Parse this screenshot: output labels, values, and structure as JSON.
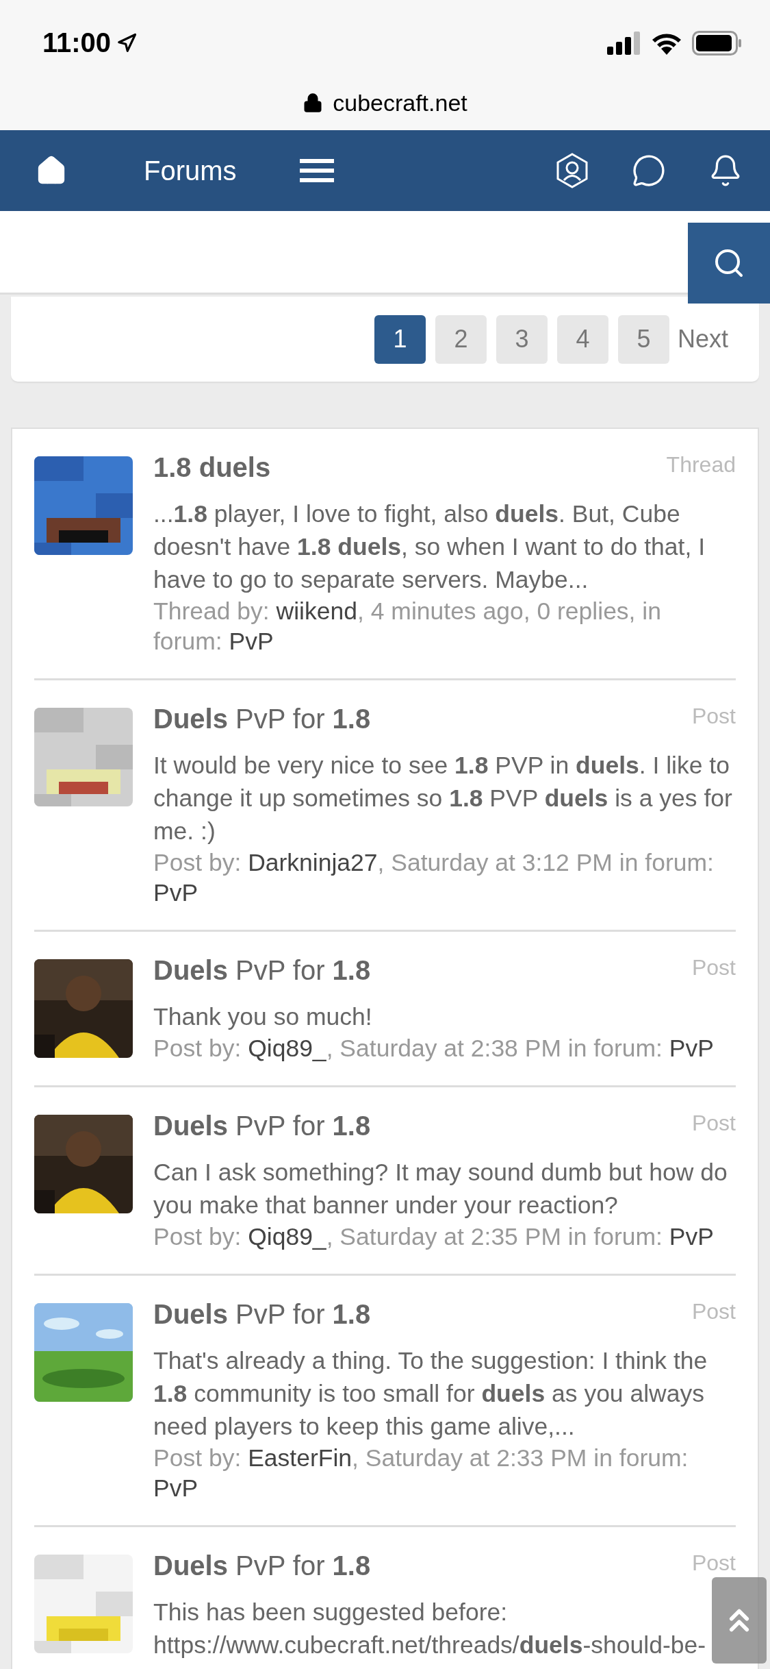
{
  "status_bar": {
    "time": "11:00"
  },
  "browser": {
    "url": "cubecraft.net"
  },
  "nav": {
    "title": "Forums"
  },
  "pagination": {
    "pages": [
      {
        "label": "1",
        "selected": true
      },
      {
        "label": "2",
        "selected": false
      },
      {
        "label": "3",
        "selected": false
      },
      {
        "label": "4",
        "selected": false
      },
      {
        "label": "5",
        "selected": false
      }
    ],
    "next": "Next"
  },
  "results": [
    {
      "title": "**1.8 duels**",
      "type": "Thread",
      "snippet": "...**1.8** player, I love to fight, also **duels**. But, Cube doesn't have **1.8 duels**, so when I want to do that, I have to go to separate servers. Maybe...",
      "meta": {
        "prefix": "Thread by:",
        "author": "wiikend",
        "details": ", 4 minutes ago, 0 replies, in forum:",
        "forum": "PvP"
      }
    },
    {
      "title": "**Duels** PvP for **1.8**",
      "type": "Post",
      "snippet": "It would be very nice to see **1.8** PVP in **duels**. I like to change it up sometimes so **1.8** PVP **duels** is a yes for me. :)",
      "meta": {
        "prefix": "Post by:",
        "author": "Darkninja27",
        "details": ", Saturday at 3:12 PM in forum:",
        "forum": "PvP"
      }
    },
    {
      "title": "**Duels** PvP for **1.8**",
      "type": "Post",
      "snippet": "Thank you so much!",
      "meta": {
        "prefix": "Post by:",
        "author": "Qiq89_",
        "details": ", Saturday at 2:38 PM in forum:",
        "forum": "PvP"
      }
    },
    {
      "title": "**Duels** PvP for **1.8**",
      "type": "Post",
      "snippet": "Can I ask something? It may sound dumb but how do you make that banner under your reaction?",
      "meta": {
        "prefix": "Post by:",
        "author": "Qiq89_",
        "details": ", Saturday at 2:35 PM in forum:",
        "forum": "PvP"
      }
    },
    {
      "title": "**Duels** PvP for **1.8**",
      "type": "Post",
      "snippet": "That's already a thing. To the suggestion: I think the **1.8** community is too small for **duels** as you always need players to keep this game alive,...",
      "meta": {
        "prefix": "Post by:",
        "author": "EasterFin",
        "details": ", Saturday at 2:33 PM in forum:",
        "forum": "PvP"
      }
    },
    {
      "title": "**Duels** PvP for **1.8**",
      "type": "Post",
      "snippet": "This has been suggested before: https://www.cubecraft.net/threads/**duels**-should-be-"
    }
  ]
}
